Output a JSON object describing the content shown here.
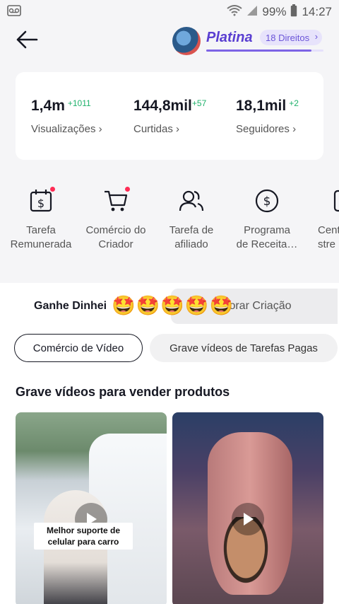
{
  "status_bar": {
    "left_icon": "voicemail-icon",
    "battery": "99%",
    "time": "14:27"
  },
  "header": {
    "tier_name": "Platina",
    "tier_pill": "18 Direitos",
    "tier_progress": 0.9
  },
  "stats": [
    {
      "value": "1,4m",
      "delta": "+1011",
      "label": "Visualizações"
    },
    {
      "value": "144,8mil",
      "delta": "+57",
      "label": "Curtidas"
    },
    {
      "value": "18,1mil",
      "delta": "+2",
      "label": "Seguidores"
    }
  ],
  "actions": [
    {
      "label": "Tarefa\nRemunerada",
      "icon": "dollar-calendar-icon",
      "dot": true
    },
    {
      "label": "Comércio do\nCriador",
      "icon": "cart-icon",
      "dot": true
    },
    {
      "label": "Tarefa de\nafiliado",
      "icon": "affiliate-people-icon",
      "dot": false
    },
    {
      "label": "Programa\nde Receita…",
      "icon": "dollar-circle-icon",
      "dot": false
    },
    {
      "label": "Cent\nstre",
      "icon": "creator-center-icon",
      "dot": false
    }
  ],
  "tabs": {
    "active": "Ganhe Dinhei",
    "inactive": "lhorar Criação",
    "emojis": "🤩🤩🤩🤩🤩"
  },
  "chips": {
    "active": "Comércio de Vídeo",
    "inactive": "Grave vídeos de Tarefas Pagas"
  },
  "section_title": "Grave vídeos para vender produtos",
  "videos": [
    {
      "caption": "Melhor suporte de celular para carro"
    },
    {
      "caption": ""
    }
  ],
  "colors": {
    "accent": "#5a3fd1",
    "positive": "#20b26c",
    "notification": "#fe2c55"
  }
}
